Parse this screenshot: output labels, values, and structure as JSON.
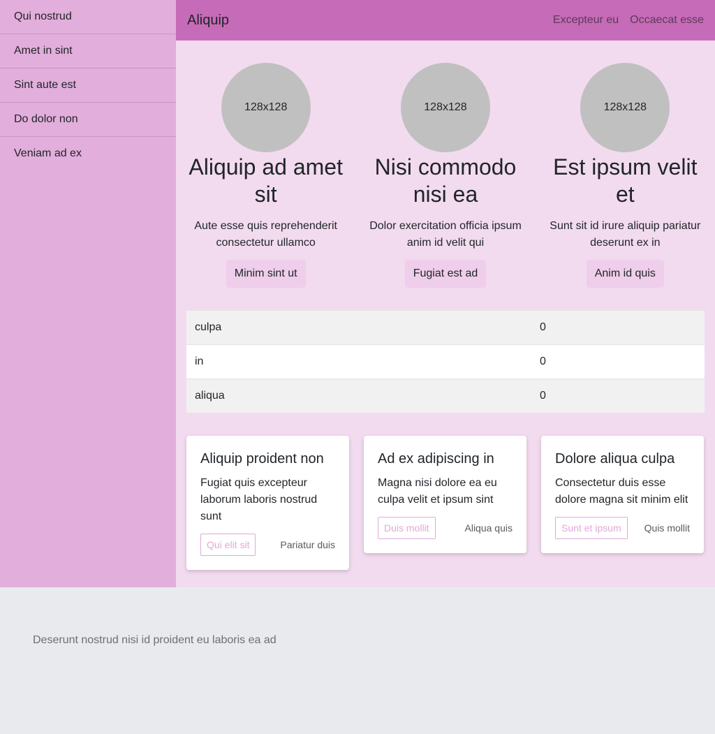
{
  "sidebar": {
    "items": [
      {
        "label": "Qui nostrud"
      },
      {
        "label": "Amet in sint"
      },
      {
        "label": "Sint aute est"
      },
      {
        "label": "Do dolor non"
      },
      {
        "label": "Veniam ad ex"
      }
    ]
  },
  "topbar": {
    "brand": "Aliquip",
    "links": [
      "Excepteur eu",
      "Occaecat esse"
    ]
  },
  "features": [
    {
      "avatar": "128x128",
      "title": "Aliquip ad amet sit",
      "text": "Aute esse quis reprehenderit consectetur ullamco",
      "button": "Minim sint ut"
    },
    {
      "avatar": "128x128",
      "title": "Nisi commodo nisi ea",
      "text": "Dolor exercitation officia ipsum anim id velit qui",
      "button": "Fugiat est ad"
    },
    {
      "avatar": "128x128",
      "title": "Est ipsum velit et",
      "text": "Sunt sit id irure aliquip pariatur deserunt ex in",
      "button": "Anim id quis"
    }
  ],
  "table": {
    "rows": [
      {
        "name": "culpa",
        "value": "0"
      },
      {
        "name": "in",
        "value": "0"
      },
      {
        "name": "aliqua",
        "value": "0"
      }
    ]
  },
  "cards": [
    {
      "title": "Aliquip proident non",
      "text": "Fugiat quis excepteur laborum laboris nostrud sunt",
      "primary": "Qui elit sit",
      "secondary": "Pariatur duis"
    },
    {
      "title": "Ad ex adipiscing in",
      "text": "Magna nisi dolore ea eu culpa velit et ipsum sint",
      "primary": "Duis mollit",
      "secondary": "Aliqua quis"
    },
    {
      "title": "Dolore aliqua culpa",
      "text": "Consectetur duis esse dolore magna sit minim elit",
      "primary": "Sunt et ipsum",
      "secondary": "Quis mollit"
    }
  ],
  "footer": {
    "text": "Deserunt nostrud nisi id proident eu laboris ea ad"
  },
  "colors": {
    "sidebar_bg": "#e2aedb",
    "topbar_bg": "#c66bb8",
    "main_bg": "#f2dbef",
    "footer_bg": "#e9eaee",
    "accent": "#e2a8da"
  }
}
